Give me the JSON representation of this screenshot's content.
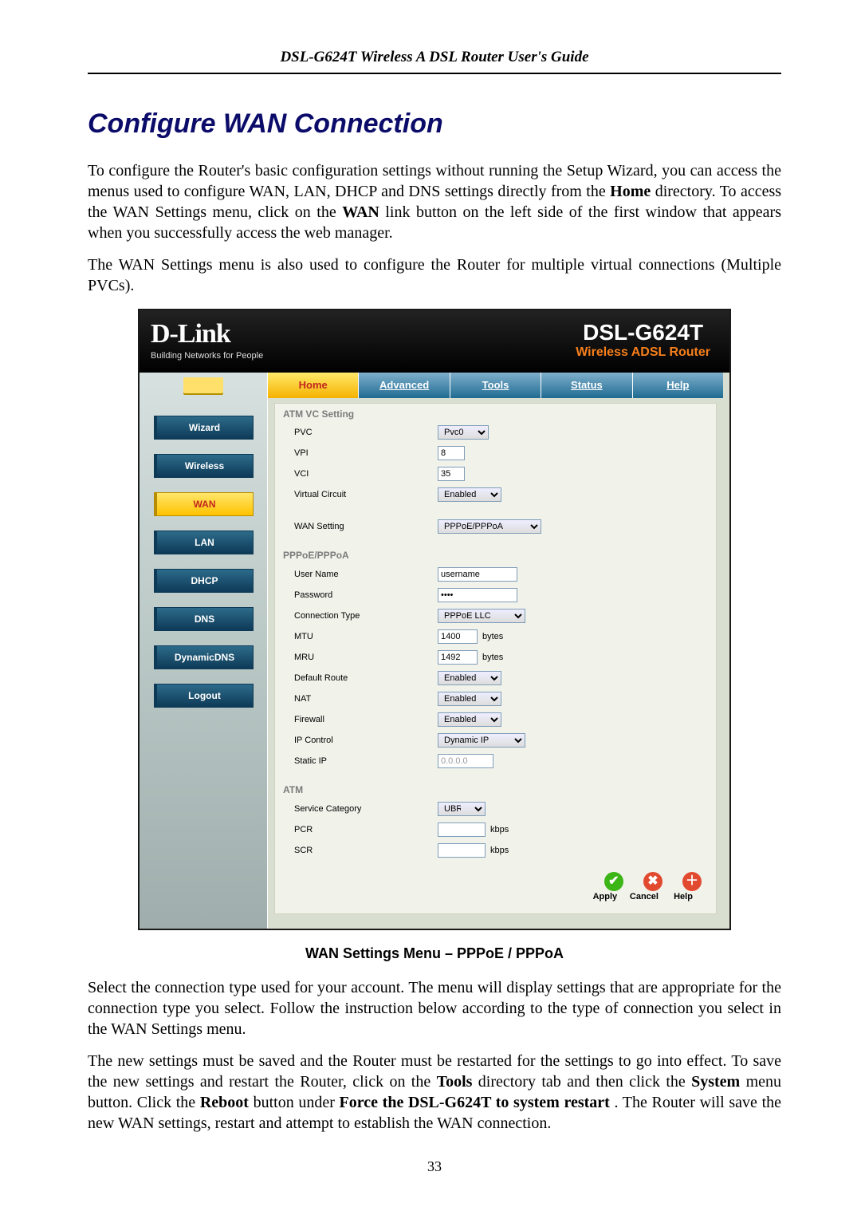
{
  "doc": {
    "header": "DSL-G624T Wireless A DSL Router User's Guide",
    "h1": "Configure WAN Connection",
    "p1a": "To configure the Router's basic configuration settings without running the Setup Wizard, you can access the menus used to configure WAN, LAN, DHCP and DNS settings directly from the ",
    "p1_home": "Home",
    "p1b": " directory. To access the WAN Settings menu, click on the ",
    "p1_wan": "WAN",
    "p1c": " link button on the left side of the first window that appears when you successfully access the web manager.",
    "p2": "The WAN Settings menu is also used to configure the Router for multiple virtual connections (Multiple PVCs).",
    "caption": "WAN Settings Menu – PPPoE / PPPoA",
    "p3": "Select the connection type used for your account. The menu will display settings that are appropriate for the connection type you select. Follow the instruction below according to the type of connection you select in the WAN Settings menu.",
    "p4a": "The new settings must be saved and the Router must be restarted for the settings to go into effect. To save the new settings and restart the Router, click on the ",
    "p4_tools": "Tools",
    "p4b": " directory tab and then click the ",
    "p4_system": "System",
    "p4c": " menu button. Click the ",
    "p4_reboot": "Reboot",
    "p4d": " button under ",
    "p4_force": "Force the DSL-G624T to system restart",
    "p4e": ". The Router will save the new WAN settings, restart and attempt to establish the WAN connection.",
    "page_num": "33"
  },
  "router": {
    "brand": "D-Link",
    "brand_tag": "Building Networks for People",
    "model": "DSL-G624T",
    "model_sub": "Wireless ADSL Router",
    "tabs": {
      "home": "Home",
      "advanced": "Advanced",
      "tools": "Tools",
      "status": "Status",
      "help": "Help"
    },
    "side": {
      "wizard": "Wizard",
      "wireless": "Wireless",
      "wan": "WAN",
      "lan": "LAN",
      "dhcp": "DHCP",
      "dns": "DNS",
      "ddns": "DynamicDNS",
      "logout": "Logout"
    },
    "sections": {
      "atm_vc": "ATM VC Setting",
      "pppoe": "PPPoE/PPPoA",
      "atm": "ATM"
    },
    "labels": {
      "pvc": "PVC",
      "vpi": "VPI",
      "vci": "VCI",
      "vc": "Virtual Circuit",
      "wan_setting": "WAN Setting",
      "user": "User Name",
      "pass": "Password",
      "ctype": "Connection Type",
      "mtu": "MTU",
      "mru": "MRU",
      "droute": "Default Route",
      "nat": "NAT",
      "fw": "Firewall",
      "ipctl": "IP Control",
      "sip": "Static IP",
      "svc": "Service Category",
      "pcr": "PCR",
      "scr": "SCR"
    },
    "values": {
      "pvc": "Pvc0",
      "vpi": "8",
      "vci": "35",
      "vc": "Enabled",
      "wan_setting": "PPPoE/PPPoA",
      "user": "username",
      "pass": "••••",
      "ctype": "PPPoE LLC",
      "mtu": "1400",
      "mru": "1492",
      "droute": "Enabled",
      "nat": "Enabled",
      "fw": "Enabled",
      "ipctl": "Dynamic IP",
      "sip": "0.0.0.0",
      "svc": "UBR",
      "pcr": "",
      "scr": ""
    },
    "units": {
      "bytes": "bytes",
      "kbps": "kbps"
    },
    "buttons": {
      "apply": "Apply",
      "cancel": "Cancel",
      "help": "Help"
    }
  }
}
